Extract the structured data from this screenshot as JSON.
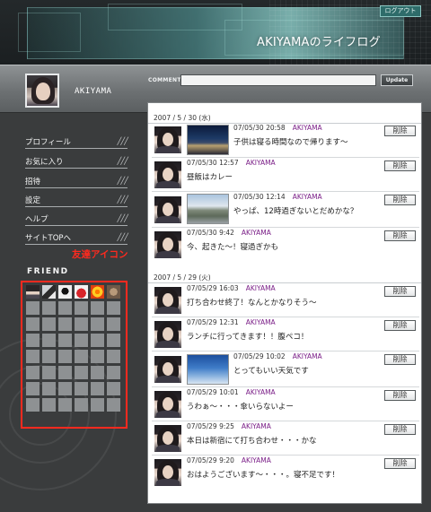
{
  "header": {
    "logout_label": "ログアウト",
    "site_title": "AKIYAMAのライフログ"
  },
  "profile": {
    "username": "AKIYAMA",
    "comment_label": "COMMENT",
    "comment_value": "",
    "update_label": "Update"
  },
  "nav": [
    {
      "label": "プロフィール"
    },
    {
      "label": "お気に入り"
    },
    {
      "label": "招待"
    },
    {
      "label": "設定"
    },
    {
      "label": "ヘルプ"
    },
    {
      "label": "サイトTOPへ"
    }
  ],
  "friends": {
    "label": "FRIEND",
    "annotation": "友達アイコン"
  },
  "feed": {
    "delete_label": "削除",
    "groups": [
      {
        "date": "2007 / 5 / 30 (水)",
        "entries": [
          {
            "time": "07/05/30  20:58",
            "author": "AKIYAMA",
            "text": "子供は寝る時間なので帰ります〜"
          },
          {
            "time": "07/05/30  12:57",
            "author": "AKIYAMA",
            "text": "昼飯はカレー"
          },
          {
            "time": "07/05/30  12:14",
            "author": "AKIYAMA",
            "text": "やっぱ、12時過ぎないとだめかな？"
          },
          {
            "time": "07/05/30    9:42",
            "author": "AKIYAMA",
            "text": "今、起きた〜！寝過ぎかも"
          }
        ]
      },
      {
        "date": "2007 / 5 / 29 (火)",
        "entries": [
          {
            "time": "07/05/29  16:03",
            "author": "AKIYAMA",
            "text": "打ち合わせ終了！なんとかなりそう〜"
          },
          {
            "time": "07/05/29  12:31",
            "author": "AKIYAMA",
            "text": "ランチに行ってきます！！腹ペコ！"
          },
          {
            "time": "07/05/29  10:02",
            "author": "AKIYAMA",
            "text": "とってもいい天気です"
          },
          {
            "time": "07/05/29  10:01",
            "author": "AKIYAMA",
            "text": "うわぁ〜・・・傘いらないよー"
          },
          {
            "time": "07/05/29    9:25",
            "author": "AKIYAMA",
            "text": "本日は新宿にて打ち合わせ・・・かな"
          },
          {
            "time": "07/05/29    9:20",
            "author": "AKIYAMA",
            "text": "おはようございます〜・・・。寝不足です！"
          }
        ]
      }
    ]
  }
}
